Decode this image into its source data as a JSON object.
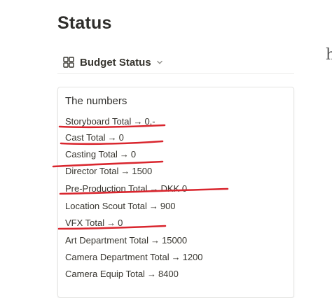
{
  "page": {
    "title": "Status"
  },
  "view": {
    "label": "Budget Status",
    "icon": "grid-icon",
    "dropdown_icon": "chevron-down-icon"
  },
  "card": {
    "title": "The numbers",
    "arrow": "→",
    "rows": [
      {
        "name": "Storyboard Total",
        "value": "0,-"
      },
      {
        "name": "Cast Total",
        "value": "0"
      },
      {
        "name": "Casting Total",
        "value": "0"
      },
      {
        "name": "Director Total",
        "value": "1500"
      },
      {
        "name": "Pre-Production Total",
        "value": "DKK 0"
      },
      {
        "name": "Location Scout Total",
        "value": "900"
      },
      {
        "name": "VFX Total",
        "value": "0"
      },
      {
        "name": "Art Department Total",
        "value": "15000"
      },
      {
        "name": "Camera Department Total",
        "value": "1200"
      },
      {
        "name": "Camera Equip Total",
        "value": "8400"
      }
    ]
  },
  "edge_glyph": "h",
  "colors": {
    "annotation": "#d9262e",
    "text": "#37352f"
  }
}
